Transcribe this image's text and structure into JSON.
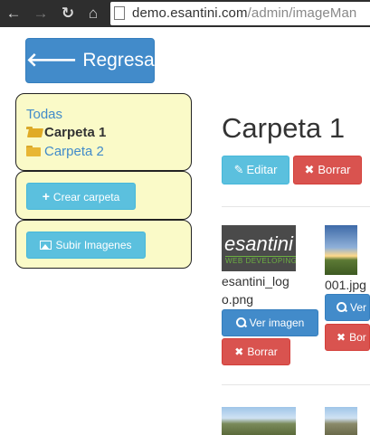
{
  "browser": {
    "url_host": "demo.esantini.com",
    "url_path": "/admin/imageMan"
  },
  "sidebar": {
    "back_label": "Regresar",
    "tree": {
      "all_label": "Todas",
      "folders": [
        {
          "label": "Carpeta 1",
          "active": true
        },
        {
          "label": "Carpeta 2",
          "active": false
        }
      ]
    },
    "create_folder_label": "Crear carpeta",
    "upload_images_label": "Subir Imagenes"
  },
  "main": {
    "title": "Carpeta 1",
    "edit_label": "Editar",
    "delete_label": "Borrar",
    "images": [
      {
        "filename": "esantini_logo.png",
        "view_label": "Ver imagen",
        "delete_label": "Borrar",
        "logo_text": "esantini",
        "logo_sub": "WEB DEVELOPING"
      },
      {
        "filename": "001.jpg",
        "view_label": "Ver",
        "delete_label": "Bor"
      }
    ]
  },
  "colors": {
    "primary": "#428bca",
    "info": "#5bc0de",
    "danger": "#d9534f",
    "panel_bg": "#fafac8",
    "folder": "#e8b634"
  }
}
